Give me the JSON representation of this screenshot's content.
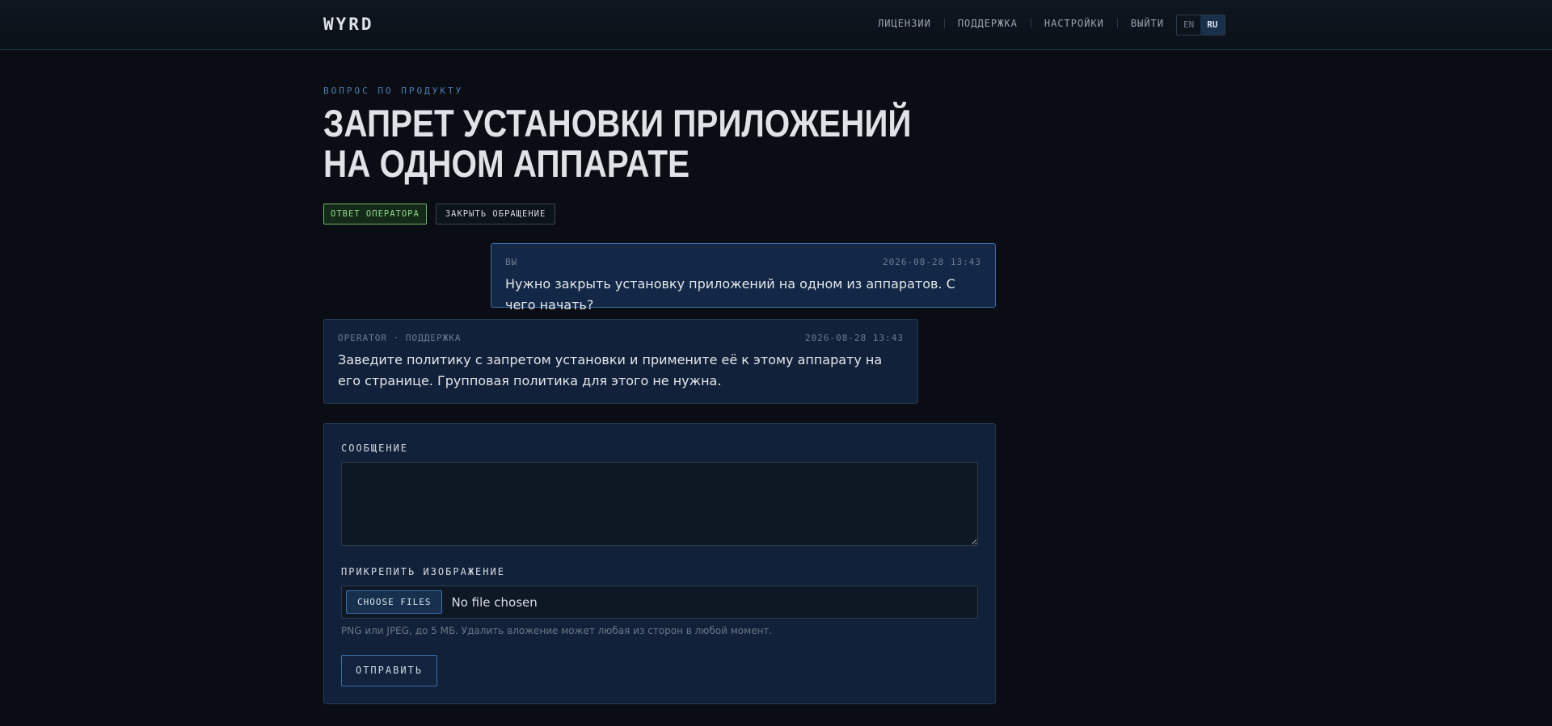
{
  "header": {
    "logo": "WYRD",
    "nav": [
      {
        "label": "ЛИЦЕНЗИИ"
      },
      {
        "label": "ПОДДЕРЖКА"
      },
      {
        "label": "НАСТРОЙКИ"
      },
      {
        "label": "ВЫЙТИ"
      }
    ],
    "languages": [
      {
        "label": "EN",
        "active": false
      },
      {
        "label": "RU",
        "active": true
      }
    ]
  },
  "ticket": {
    "category": "ВОПРОС ПО ПРОДУКТУ",
    "title": "ЗАПРЕТ УСТАНОВКИ ПРИЛОЖЕНИЙ НА ОДНОМ АППАРАТЕ",
    "status_badge": "ОТВЕТ ОПЕРАТОРА",
    "close_label": "ЗАКРЫТЬ ОБРАЩЕНИЕ"
  },
  "messages": [
    {
      "author": "ВЫ",
      "time": "2026-08-28 13:43",
      "text": "Нужно закрыть установку приложений на одном из аппаратов. С чего начать?"
    },
    {
      "author": "OPERATOR · ПОДДЕРЖКА",
      "time": "2026-08-28 13:43",
      "text": "Заведите политику с запретом установки и примените её к этому аппарату на его странице. Групповая политика для этого не нужна."
    }
  ],
  "form": {
    "message_label": "СООБЩЕНИЕ",
    "message_value": "",
    "attach_label": "ПРИКРЕПИТЬ ИЗОБРАЖЕНИЕ",
    "choose_files": "CHOOSE FILES",
    "file_status": "No file chosen",
    "hint": "PNG или JPEG, до 5 МБ. Удалить вложение может любая из сторон в любой момент.",
    "submit": "ОТПРАВИТЬ"
  },
  "colors": {
    "background": "#0a0e14",
    "panel": "#12213a",
    "accent": "#3c6ea8",
    "status_green": "#8fd58a"
  }
}
